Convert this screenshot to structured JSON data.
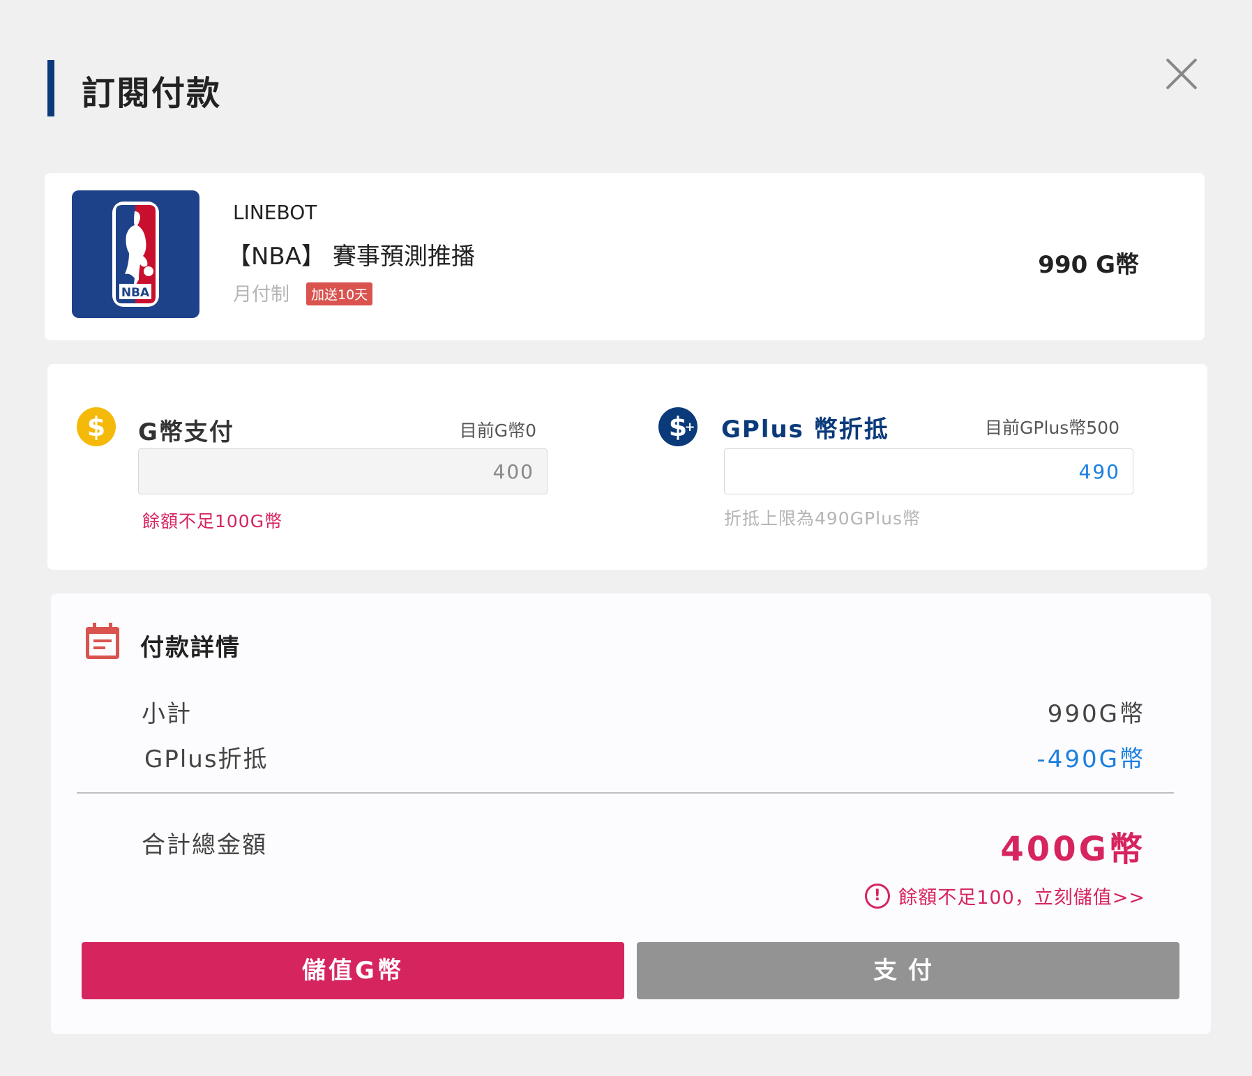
{
  "header": {
    "title": "訂閱付款"
  },
  "product": {
    "bot_name": "LINEBOT",
    "name": "【NBA】 賽事預測推播",
    "plan": "月付制",
    "badge": "加送10天",
    "price": "990 G幣",
    "logo_text": "NBA"
  },
  "payment": {
    "g": {
      "label": "G幣支付",
      "balance": "目前G幣0",
      "input_value": "400",
      "hint": "餘額不足100G幣"
    },
    "gplus": {
      "label": "GPlus 幣折抵",
      "balance": "目前GPlus幣500",
      "input_value": "490",
      "hint": "折抵上限為490GPlus幣"
    }
  },
  "details": {
    "title": "付款詳情",
    "subtotal_label": "小計",
    "subtotal_value": "990G幣",
    "discount_label": "GPlus折抵",
    "discount_value": "-490G幣",
    "total_label": "合計總金額",
    "total_value": "400G幣",
    "warning": "餘額不足100，立刻儲值>>"
  },
  "buttons": {
    "topup": "儲值G幣",
    "pay": "支付"
  },
  "colors": {
    "accent_pink": "#d6245f",
    "navy": "#0b3a7a",
    "gold": "#f5b90a",
    "link_blue": "#1a7fe0"
  }
}
